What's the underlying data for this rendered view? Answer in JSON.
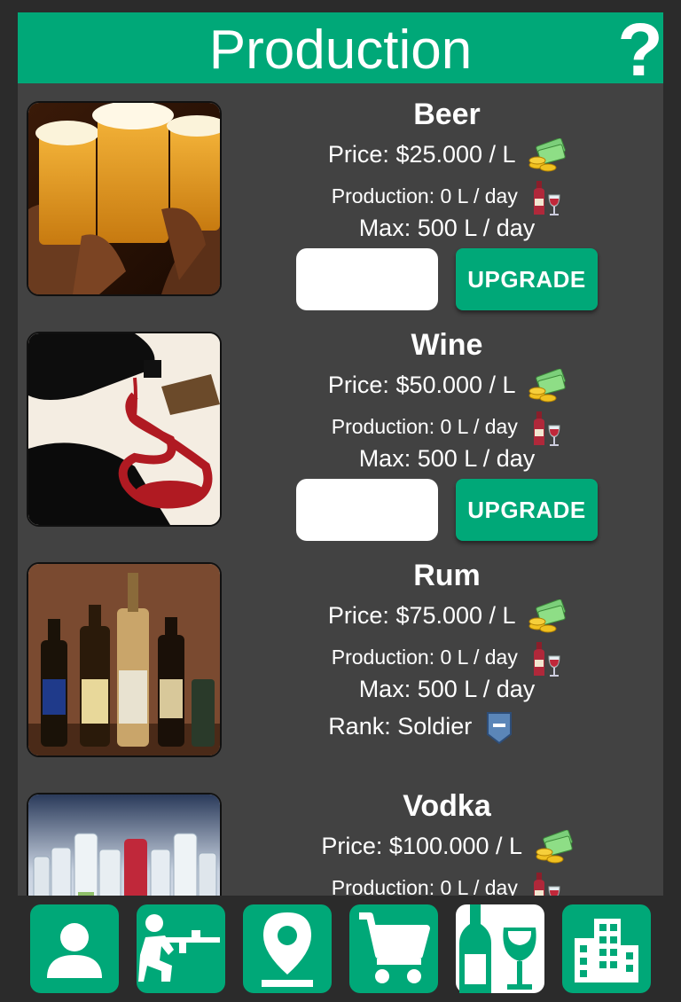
{
  "header": {
    "title": "Production",
    "help_label": "?"
  },
  "items": [
    {
      "name": "Beer",
      "price": "Price: $25.000 / L",
      "production": "Production: 0 L / day",
      "max": "Max: 500 L / day",
      "quantity_value": "",
      "upgrade_label": "UPGRADE"
    },
    {
      "name": "Wine",
      "price": "Price: $50.000 / L",
      "production": "Production: 0 L / day",
      "max": "Max: 500 L / day",
      "quantity_value": "",
      "upgrade_label": "UPGRADE"
    },
    {
      "name": "Rum",
      "price": "Price: $75.000 / L",
      "production": "Production: 0 L / day",
      "max": "Max: 500 L / day",
      "rank": "Rank: Soldier"
    },
    {
      "name": "Vodka",
      "price": "Price: $100.000 / L",
      "production": "Production: 0 L / day"
    }
  ],
  "nav": [
    {
      "icon": "person-icon",
      "active": false
    },
    {
      "icon": "soldier-rifle-icon",
      "active": false
    },
    {
      "icon": "map-pin-icon",
      "active": false
    },
    {
      "icon": "shopping-cart-icon",
      "active": false
    },
    {
      "icon": "bottle-glass-icon",
      "active": true
    },
    {
      "icon": "building-icon",
      "active": false
    }
  ],
  "colors": {
    "accent": "#00a878",
    "panel": "#424242",
    "background": "#2b2b2b"
  }
}
